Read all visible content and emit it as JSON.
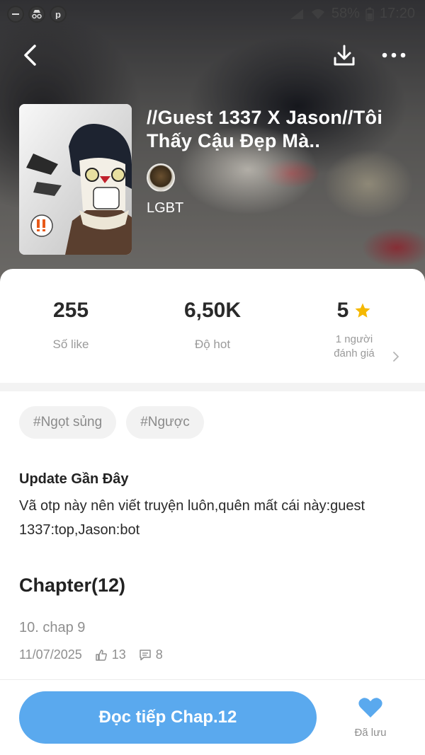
{
  "statusbar": {
    "battery": "58%",
    "time": "17:20"
  },
  "story": {
    "title": "//Guest 1337 X Jason//Tôi Thấy Cậu Đẹp Mà..",
    "category": "LGBT"
  },
  "stats": {
    "likes_value": "255",
    "likes_label": "Số like",
    "hot_value": "6,50K",
    "hot_label": "Độ hot",
    "rating_value": "5",
    "rating_label_line1": "1 người",
    "rating_label_line2": "đánh giá"
  },
  "tags": [
    "#Ngọt sủng",
    "#Ngược"
  ],
  "update": {
    "heading": "Update Gần Đây",
    "text": "Vã otp này nên viết truyện luôn,quên mất cái này:guest 1337:top,Jason:bot"
  },
  "chapters": {
    "heading": "Chapter(12)",
    "items": [
      {
        "name": "10. chap 9",
        "date": "11/07/2025",
        "likes": "13",
        "comments": "8"
      }
    ]
  },
  "bottom": {
    "read_button": "Đọc tiếp Chap.12",
    "saved_label": "Đã lưu"
  },
  "colors": {
    "accent": "#5aa9ee",
    "star": "#f5b800",
    "heart": "#5aa9ee"
  },
  "icons": [
    "back-arrow-icon",
    "download-icon",
    "more-icon",
    "star-icon",
    "chevron-right-icon",
    "thumbs-up-icon",
    "comment-icon",
    "heart-icon"
  ]
}
